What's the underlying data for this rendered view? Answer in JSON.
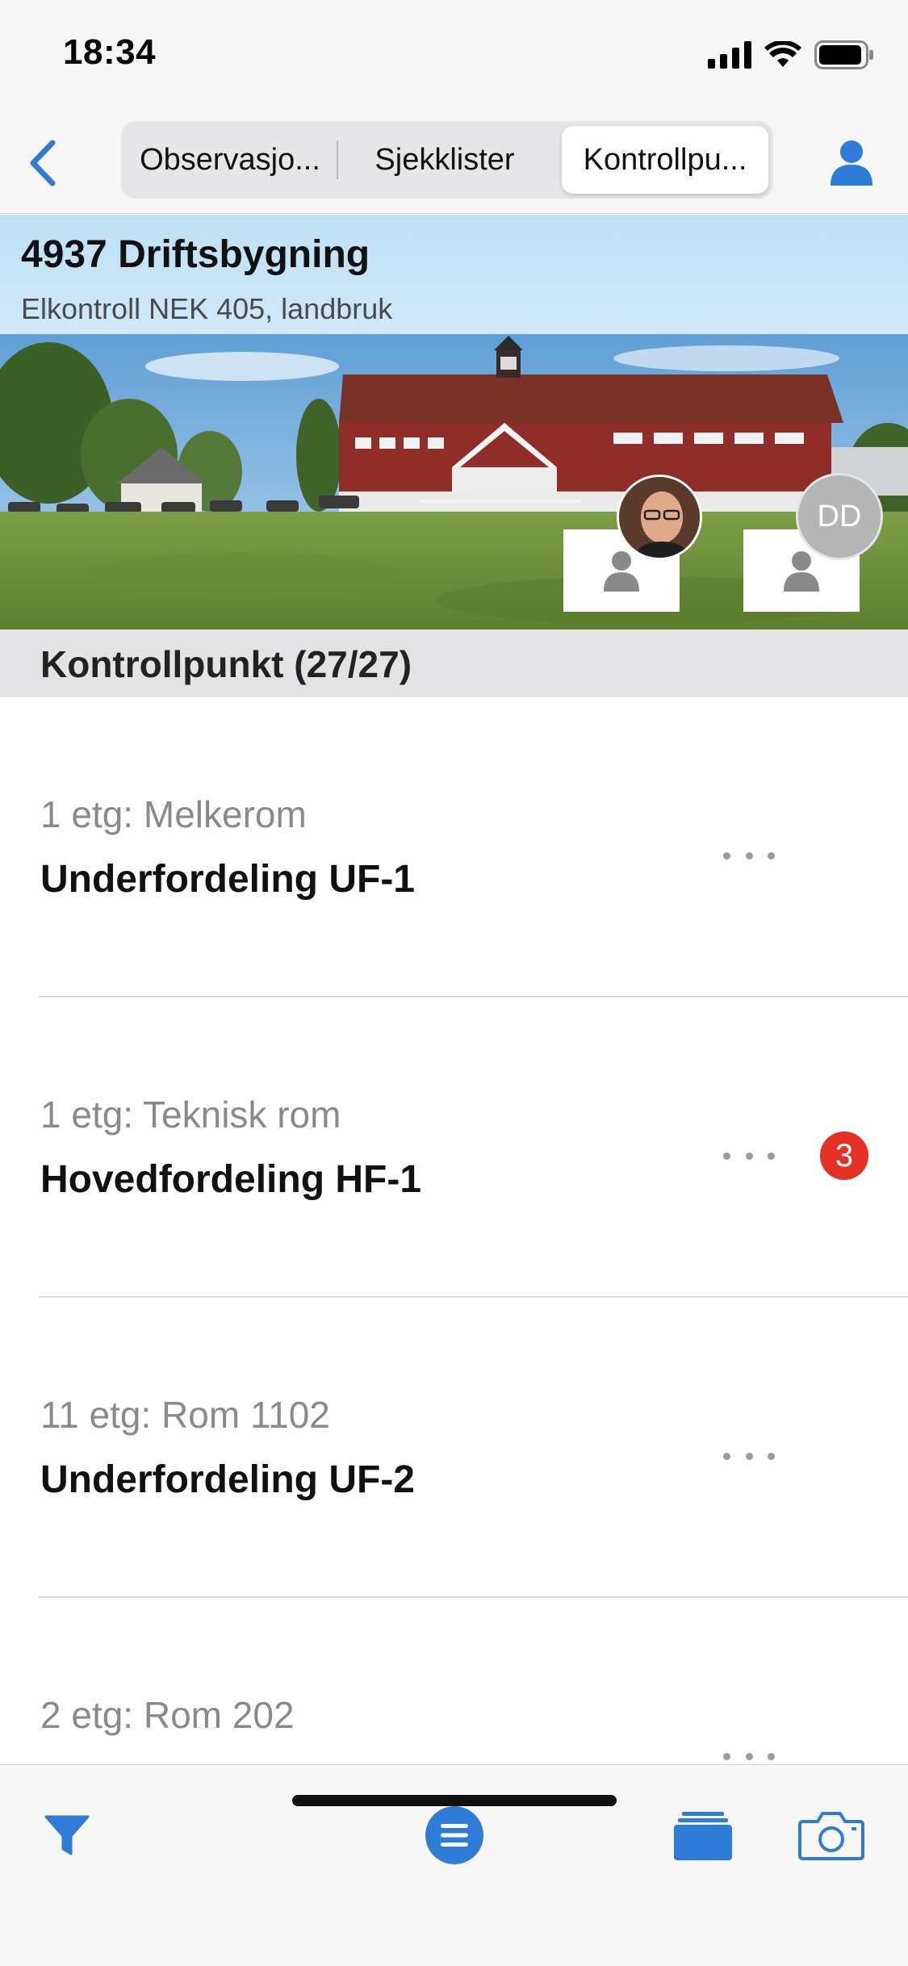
{
  "status_bar": {
    "time": "18:34"
  },
  "nav": {
    "segments": [
      "Observasjo...",
      "Sjekklister",
      "Kontrollpu..."
    ],
    "active_segment": "Kontrollpu..."
  },
  "header": {
    "title": "4937 Driftsbygning",
    "subtitle": "Elkontroll NEK 405, landbruk"
  },
  "avatars": {
    "initials": "DD"
  },
  "section": {
    "title": "Kontrollpunkt (27/27)"
  },
  "items": [
    {
      "location": "1 etg: Melkerom",
      "name": "Underfordeling UF-1",
      "badge": ""
    },
    {
      "location": "1 etg: Teknisk rom",
      "name": "Hovedfordeling HF-1",
      "badge": "3"
    },
    {
      "location": "11 etg: Rom 1102",
      "name": "Underfordeling UF-2",
      "badge": ""
    },
    {
      "location": "2 etg: Rom 202",
      "name": "",
      "badge": ""
    }
  ],
  "colors": {
    "accent": "#2f7bd8",
    "badge": "#e63026",
    "header_bg": "#bfe0f6"
  },
  "icons": {
    "back": "chevron-left-icon",
    "user": "person-icon",
    "filter": "filter-icon",
    "list": "list-icon",
    "stack": "stack-icon",
    "camera": "camera-icon"
  }
}
